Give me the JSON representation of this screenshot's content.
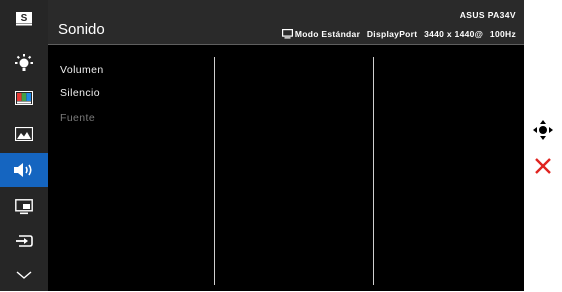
{
  "header": {
    "title": "Sonido",
    "model": "ASUS PA34V",
    "mode": "Modo Estándar",
    "port": "DisplayPort",
    "resolution": "3440 x 1440@",
    "refresh": "100Hz"
  },
  "sidebar": {
    "items": [
      {
        "icon": "splendid-s-icon",
        "active": false
      },
      {
        "icon": "brightness-icon",
        "active": false
      },
      {
        "icon": "color-bars-icon",
        "active": false
      },
      {
        "icon": "image-icon",
        "active": false
      },
      {
        "icon": "speaker-icon",
        "active": true
      },
      {
        "icon": "pip-icon",
        "active": false
      },
      {
        "icon": "input-select-icon",
        "active": false
      },
      {
        "icon": "chevron-down-icon",
        "active": false
      }
    ]
  },
  "menu": {
    "items": [
      {
        "label": "Volumen",
        "enabled": true
      },
      {
        "label": "Silencio",
        "enabled": true
      },
      {
        "label": "Fuente",
        "enabled": false
      }
    ]
  },
  "nav": {
    "icons": [
      "joystick-icon",
      "close-icon"
    ],
    "close_color": "#e0231f"
  },
  "colors": {
    "accent": "#1565c0",
    "sidebar_bg": "#262626",
    "header_bg": "#2a2a2a",
    "disabled_text": "#7a7a7a"
  }
}
